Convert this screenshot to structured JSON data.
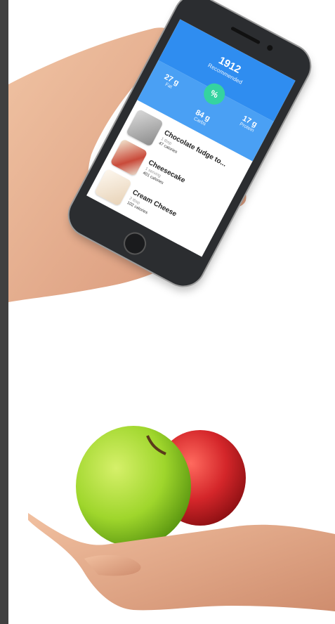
{
  "phone_app": {
    "recommended": {
      "value": "1912",
      "label": "Recommended"
    },
    "macros": {
      "fat": {
        "value": "27 g",
        "label": "Fat"
      },
      "carbs": {
        "value": "84 g",
        "label": "Carbs"
      },
      "protein": {
        "value": "17 g",
        "label": "Protein"
      }
    },
    "percent_badge": "%",
    "foods": [
      {
        "name": "Chocolate fudge to...",
        "serving": "1 tbsp",
        "calories": "47 calories",
        "icon": "fudge-topping-photo"
      },
      {
        "name": "Cheesecake",
        "serving": "1 serving",
        "calories": "401 calories",
        "icon": "cheesecake-photo"
      },
      {
        "name": "Cream Cheese",
        "serving": "2 tbsp",
        "calories": "102 calories",
        "icon": "cream-cheese-photo"
      }
    ]
  },
  "colors": {
    "header_blue": "#2f8df0",
    "band_blue": "#4aa0f4",
    "badge_green": "#35d3a0",
    "skin": "#e8b08e",
    "green_apple": "#9fd62c",
    "red_apple": "#d4262a"
  }
}
